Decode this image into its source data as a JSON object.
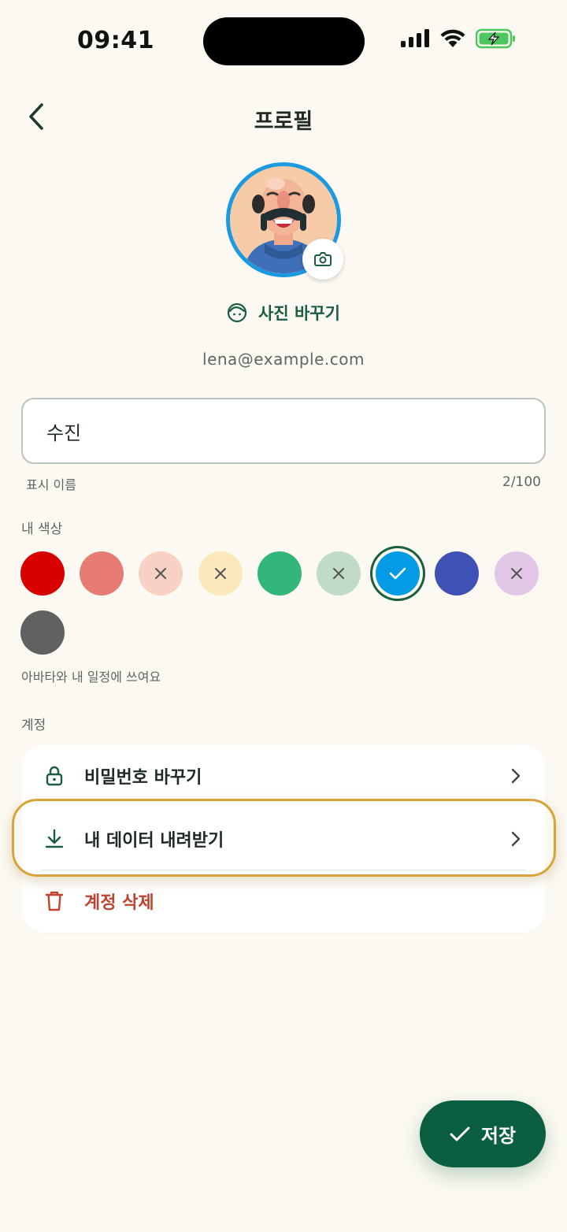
{
  "status_bar": {
    "time": "09:41"
  },
  "nav": {
    "title": "프로필"
  },
  "profile": {
    "change_photo_label": "사진 바꾸기",
    "email": "lena@example.com"
  },
  "name_field": {
    "value": "수진",
    "helper": "표시 이름",
    "counter": "2/100"
  },
  "colors": {
    "label": "내 색상",
    "hint": "아바타와 내 일정에 쓰여요",
    "swatches": [
      {
        "color": "#d90000",
        "state": "available"
      },
      {
        "color": "#e67c73",
        "state": "available"
      },
      {
        "color": "#f9d0c4",
        "state": "unavailable"
      },
      {
        "color": "#fbe8bc",
        "state": "unavailable"
      },
      {
        "color": "#33b679",
        "state": "available"
      },
      {
        "color": "#c0dcc8",
        "state": "unavailable"
      },
      {
        "color": "#039be5",
        "state": "selected"
      },
      {
        "color": "#3f51b5",
        "state": "available"
      },
      {
        "color": "#e1c6e6",
        "state": "unavailable"
      },
      {
        "color": "#616161",
        "state": "available"
      }
    ]
  },
  "account": {
    "label": "계정",
    "items": [
      {
        "label": "비밀번호 바꾸기",
        "icon": "lock-icon"
      },
      {
        "label": "내 데이터 내려받기",
        "icon": "download-icon"
      },
      {
        "label": "계정 삭제",
        "icon": "trash-icon",
        "destructive_color": "#c0432f"
      }
    ]
  },
  "save_button": {
    "label": "저장"
  },
  "accent_colors": {
    "primary": "#0b5e40",
    "highlight_ring": "#d9a33a"
  }
}
